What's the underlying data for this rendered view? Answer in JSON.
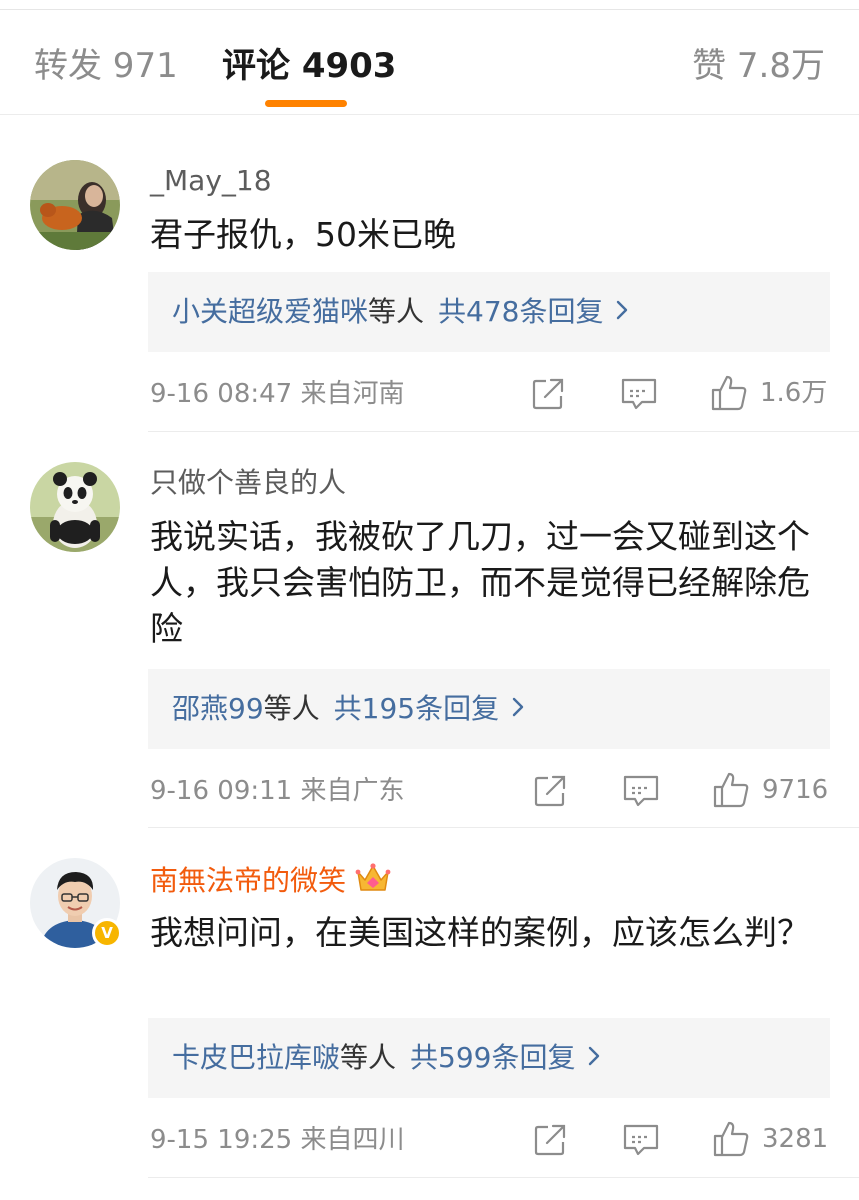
{
  "tabs": {
    "repost": "转发 971",
    "comment": "评论 4903",
    "like": "赞 7.8万"
  },
  "colors": {
    "accent": "#ff8200",
    "link": "#456d9f",
    "vip_name": "#f25b0d",
    "muted": "#8c8c8c"
  },
  "comments": [
    {
      "username": "_May_18",
      "content": "君子报仇，50米已晚",
      "reply_users": "小关超级爱猫咪",
      "reply_etc": "等人",
      "reply_count": "共478条回复",
      "meta": "9-16 08:47  来自河南",
      "likes": "1.6万",
      "avatar": "girl-with-dog-avatar"
    },
    {
      "username": "只做个善良的人",
      "content": "我说实话，我被砍了几刀，过一会又碰到这个人，我只会害怕防卫，而不是觉得已经解除危险",
      "reply_users": "邵燕99",
      "reply_etc": "等人",
      "reply_count": "共195条回复",
      "meta": "9-16 09:11  来自广东",
      "likes": "9716",
      "avatar": "panda-avatar"
    },
    {
      "username": "南無法帝的微笑",
      "content": "我想问问，在美国这样的案例，应该怎么判？",
      "reply_users": "卡皮巴拉库啵",
      "reply_etc": "等人",
      "reply_count": "共599条回复",
      "meta": "9-15 19:25  来自四川",
      "likes": "3281",
      "avatar": "young-man-avatar",
      "badge": "V"
    }
  ]
}
